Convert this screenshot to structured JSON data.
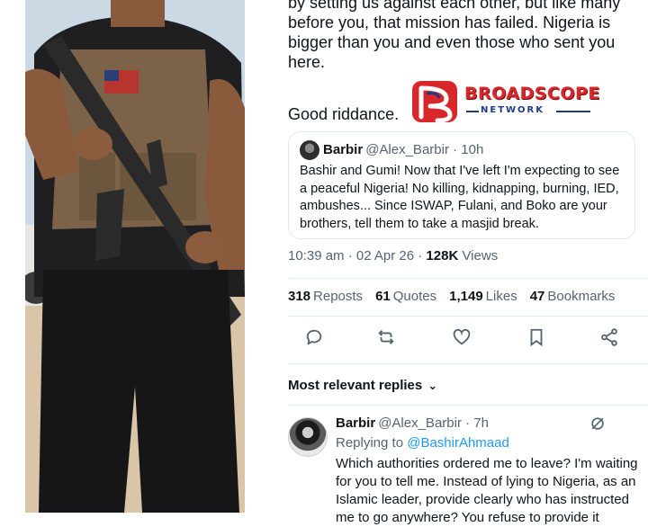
{
  "tweet": {
    "text_top": "by setting us against each other, but like many\nbefore you, that mission has failed. Nigeria is\nbigger than you and even those who sent you\nhere.",
    "text_end": "Good riddance."
  },
  "logo": {
    "word": "BROADSCOPE",
    "sub": "NETWORK",
    "colors": {
      "red": "#d9262b",
      "blue": "#1b3d86"
    }
  },
  "quote": {
    "name": "Barbir",
    "handle": "@Alex_Barbir · 10h",
    "body": "Bashir and Gumi! Now that I've left I'm expecting to see a peaceful Nigeria! No killing, kidnapping, burning, IED, ambushes... Since ISWAP, Fulani, and Boko are your brothers, tell them to take a masjid break."
  },
  "meta": {
    "timestamp": "10:39 am · 02 Apr 26 · ",
    "views_count": "128K",
    "views_label": " Views"
  },
  "stats": {
    "reposts_count": "318",
    "reposts_label": "Reposts",
    "quotes_count": "61",
    "quotes_label": "Quotes",
    "likes_count": "1,149",
    "likes_label": "Likes",
    "bookmarks_count": "47",
    "bookmarks_label": "Bookmarks"
  },
  "actions": {
    "icons": [
      "reply-icon",
      "repost-icon",
      "like-icon",
      "bookmark-icon",
      "share-icon"
    ]
  },
  "replies_header": {
    "label": "Most relevant replies",
    "chevron": "⌄"
  },
  "reply": {
    "name": "Barbir",
    "handle": "@Alex_Barbir · 7h",
    "replying_prefix": "Replying to ",
    "replying_to": "@BashirAhmaad",
    "body": "Which authorities ordered me to leave? I'm waiting for you to tell me. Instead of lying to Nigeria, as an Islamic leader, provide clearly who has instructed me to go anywhere? You refuse to provide it"
  },
  "colors": {
    "link": "#1d9bf0",
    "secondary": "#536471",
    "text": "#0f1419"
  }
}
